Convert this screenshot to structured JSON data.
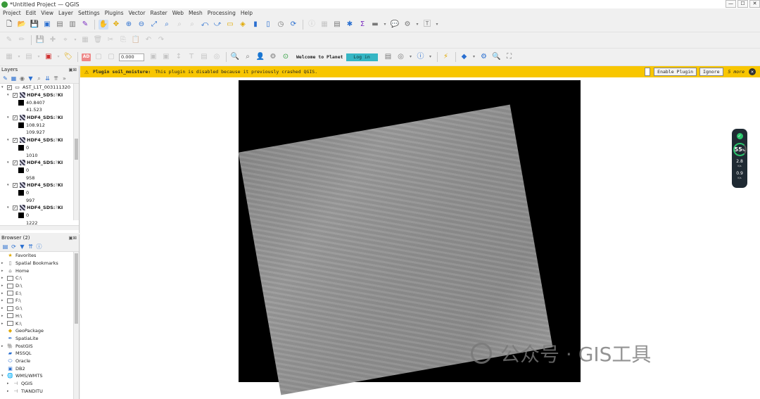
{
  "window": {
    "title": "*Untitled Project — QGIS",
    "controls": [
      "—",
      "☐",
      "✕"
    ]
  },
  "menu": [
    "Project",
    "Edit",
    "View",
    "Layer",
    "Settings",
    "Plugins",
    "Vector",
    "Raster",
    "Web",
    "Mesh",
    "Processing",
    "Help"
  ],
  "toolbar3": {
    "ad_label": "AD",
    "offset_value": "0.000",
    "welcome_text": "Welcome to Planet",
    "login_label": "Log in"
  },
  "message_bar": {
    "title": "Plugin soil_moisture:",
    "message": "This plugin is disabled because it previously crashed QGIS.",
    "enable_label": "Enable Plugin",
    "ignore_label": "Ignore",
    "more_label": "5 more"
  },
  "layers_panel": {
    "title": "Layers",
    "group": "AST_L1T_003111320",
    "items": [
      {
        "name": "HDF4_SDS:",
        "suffix": "KI",
        "min": "40.8407",
        "max": "41.523"
      },
      {
        "name": "HDF4_SDS:",
        "suffix": "KI",
        "min": "108.912",
        "max": "109.927"
      },
      {
        "name": "HDF4_SDS:",
        "suffix": "KI",
        "min": "0",
        "max": "1010"
      },
      {
        "name": "HDF4_SDS:",
        "suffix": "KI",
        "min": "0",
        "max": "958"
      },
      {
        "name": "HDF4_SDS:",
        "suffix": "KI",
        "min": "0",
        "max": "997"
      },
      {
        "name": "HDF4_SDS:",
        "suffix": "KI",
        "min": "0",
        "max": "1222"
      }
    ]
  },
  "browser_panel": {
    "title": "Browser (2)",
    "items": [
      {
        "label": "Favorites",
        "icon": "star-icon"
      },
      {
        "label": "Spatial Bookmarks",
        "icon": "bookmark-icon"
      },
      {
        "label": "Home",
        "icon": "home-icon"
      },
      {
        "label": "C:\\",
        "icon": "folder-icon"
      },
      {
        "label": "D:\\",
        "icon": "folder-icon"
      },
      {
        "label": "E:\\",
        "icon": "folder-icon"
      },
      {
        "label": "F:\\",
        "icon": "folder-icon"
      },
      {
        "label": "G:\\",
        "icon": "folder-icon"
      },
      {
        "label": "H:\\",
        "icon": "folder-icon"
      },
      {
        "label": "K:\\",
        "icon": "folder-icon"
      },
      {
        "label": "GeoPackage",
        "icon": "geopackage-icon"
      },
      {
        "label": "SpatiaLite",
        "icon": "spatialite-icon"
      },
      {
        "label": "PostGIS",
        "icon": "postgis-icon"
      },
      {
        "label": "MSSQL",
        "icon": "mssql-icon"
      },
      {
        "label": "Oracle",
        "icon": "oracle-icon"
      },
      {
        "label": "DB2",
        "icon": "db2-icon"
      },
      {
        "label": "WMS/WMTS",
        "icon": "wms-icon"
      },
      {
        "label": "QGIS",
        "icon": "wms-layer-icon"
      },
      {
        "label": "TIANDITU",
        "icon": "wms-layer-icon"
      }
    ]
  },
  "net_widget": {
    "percent": "55",
    "percent_unit": "%",
    "up": "2.8",
    "up_unit": "K/s",
    "down": "0.9",
    "down_unit": "K/s"
  },
  "watermark": {
    "text": "公众号 · GIS工具"
  },
  "colors": {
    "message_bar": "#f8c600",
    "login_button": "#35b6c4"
  }
}
